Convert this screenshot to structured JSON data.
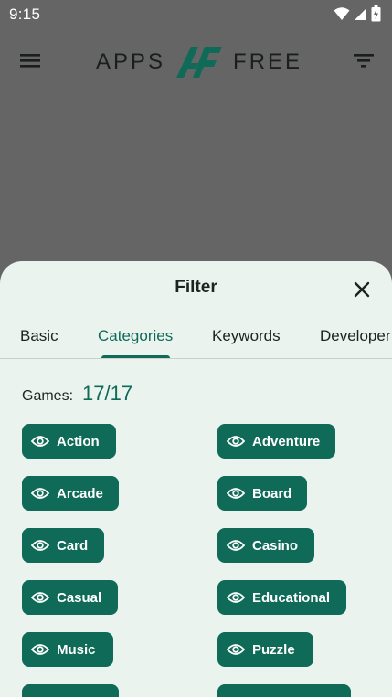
{
  "status_bar": {
    "time": "9:15"
  },
  "app_bar": {
    "logo_left": "APPS",
    "logo_right": "FREE",
    "icons": [
      "menu-icon",
      "logo-mark",
      "filter-icon"
    ]
  },
  "sheet": {
    "title": "Filter",
    "tabs": [
      {
        "label": "Basic"
      },
      {
        "label": "Categories"
      },
      {
        "label": "Keywords"
      },
      {
        "label": "Developer"
      }
    ],
    "active_tab": "Categories",
    "games_label": "Games:",
    "games_count": "17/17",
    "chips": [
      {
        "label": "Action"
      },
      {
        "label": "Adventure"
      },
      {
        "label": "Arcade"
      },
      {
        "label": "Board"
      },
      {
        "label": "Card"
      },
      {
        "label": "Casino"
      },
      {
        "label": "Casual"
      },
      {
        "label": "Educational"
      },
      {
        "label": "Music"
      },
      {
        "label": "Puzzle"
      }
    ]
  },
  "colors": {
    "scrim": "#656565",
    "sheet_bg": "#eaf3ee",
    "accent": "#0f6a58",
    "logo_mark": "#0f6a58"
  }
}
